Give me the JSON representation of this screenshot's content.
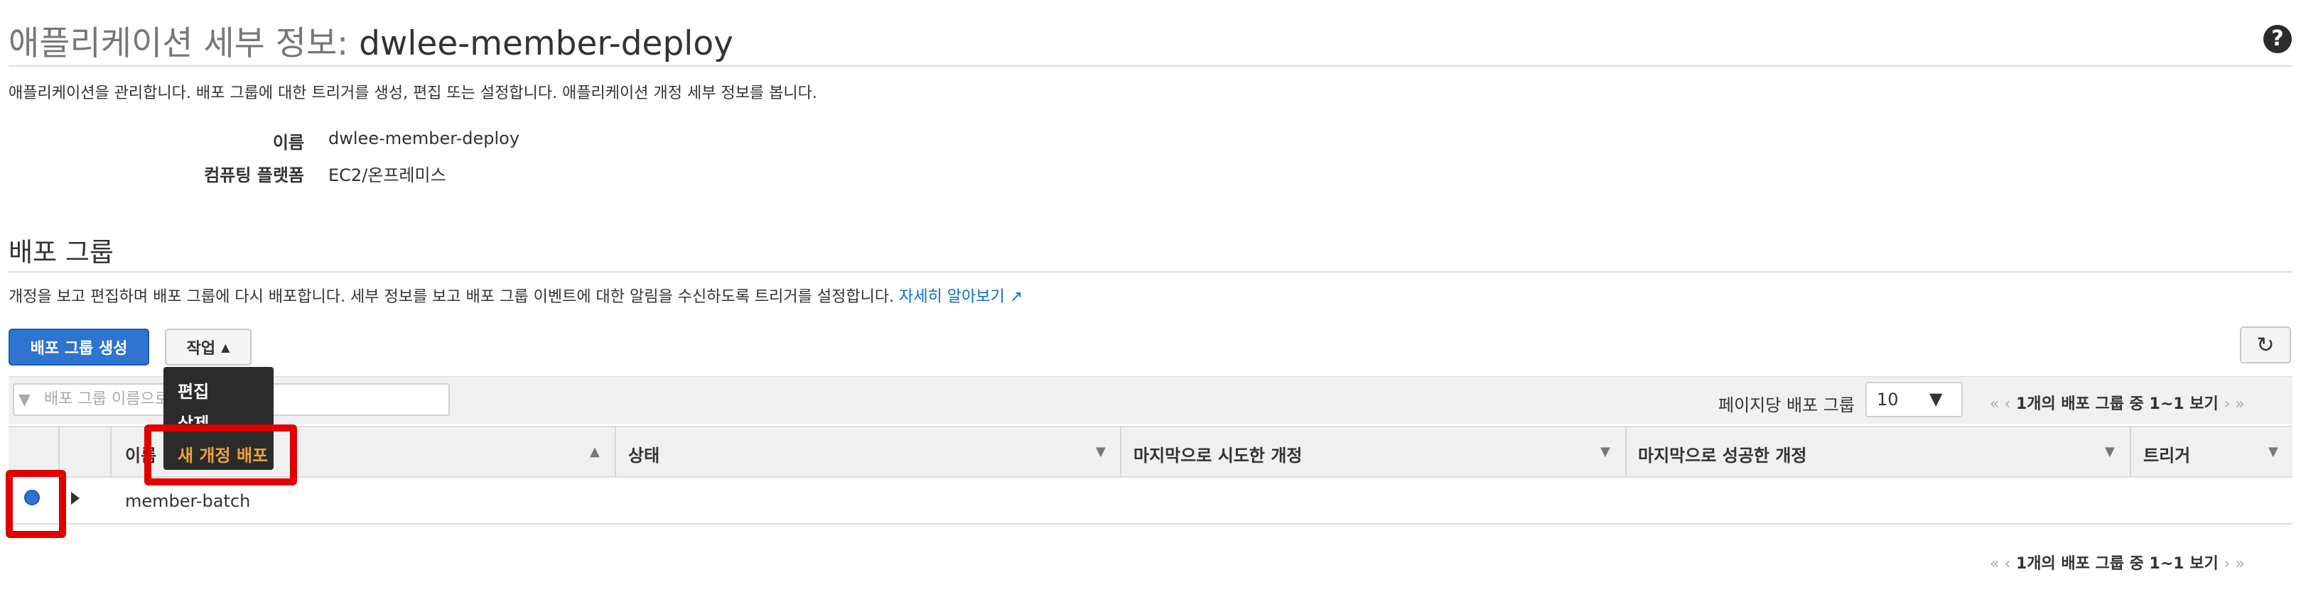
{
  "header": {
    "title_prefix": "애플리케이션 세부 정보:",
    "title_name": "dwlee-member-deploy",
    "help_icon": "?"
  },
  "app_description": "애플리케이션을 관리합니다. 배포 그룹에 대한 트리거를 생성, 편집 또는 설정합니다. 애플리케이션 개정 세부 정보를 봅니다.",
  "details": {
    "name_label": "이름",
    "name_value": "dwlee-member-deploy",
    "platform_label": "컴퓨팅 플랫폼",
    "platform_value": "EC2/온프레미스"
  },
  "deploy_groups": {
    "title": "배포 그룹",
    "description": "개정을 보고 편집하며 배포 그룹에 다시 배포합니다. 세부 정보를 보고 배포 그룹 이벤트에 대한 알림을 수신하도록 트리거를 설정합니다.",
    "learn_more": "자세히 알아보기",
    "create_button": "배포 그룹 생성",
    "actions_button": "작업",
    "actions_caret": "▲",
    "filter_placeholder": "배포 그룹 이름으로",
    "per_page_label": "페이지당 배포 그룹",
    "per_page_value": "10",
    "pager_text": "1개의 배포 그룹 중 1~1 보기",
    "pager_prev": "« ‹",
    "pager_next": "› »",
    "columns": [
      "이름",
      "상태",
      "마지막으로 시도한 개정",
      "마지막으로 성공한 개정",
      "트리거"
    ],
    "rows": [
      {
        "name": "member-batch",
        "status": "",
        "last_attempted": "",
        "last_succeeded": "",
        "trigger": ""
      }
    ]
  },
  "actions_menu": {
    "items": [
      "편집",
      "삭제",
      "새 개정 배포"
    ]
  },
  "colors": {
    "primary": "#2f74d0",
    "link": "#0a6ec7",
    "highlight": "#f0a03c",
    "annotation": "#e00000"
  }
}
